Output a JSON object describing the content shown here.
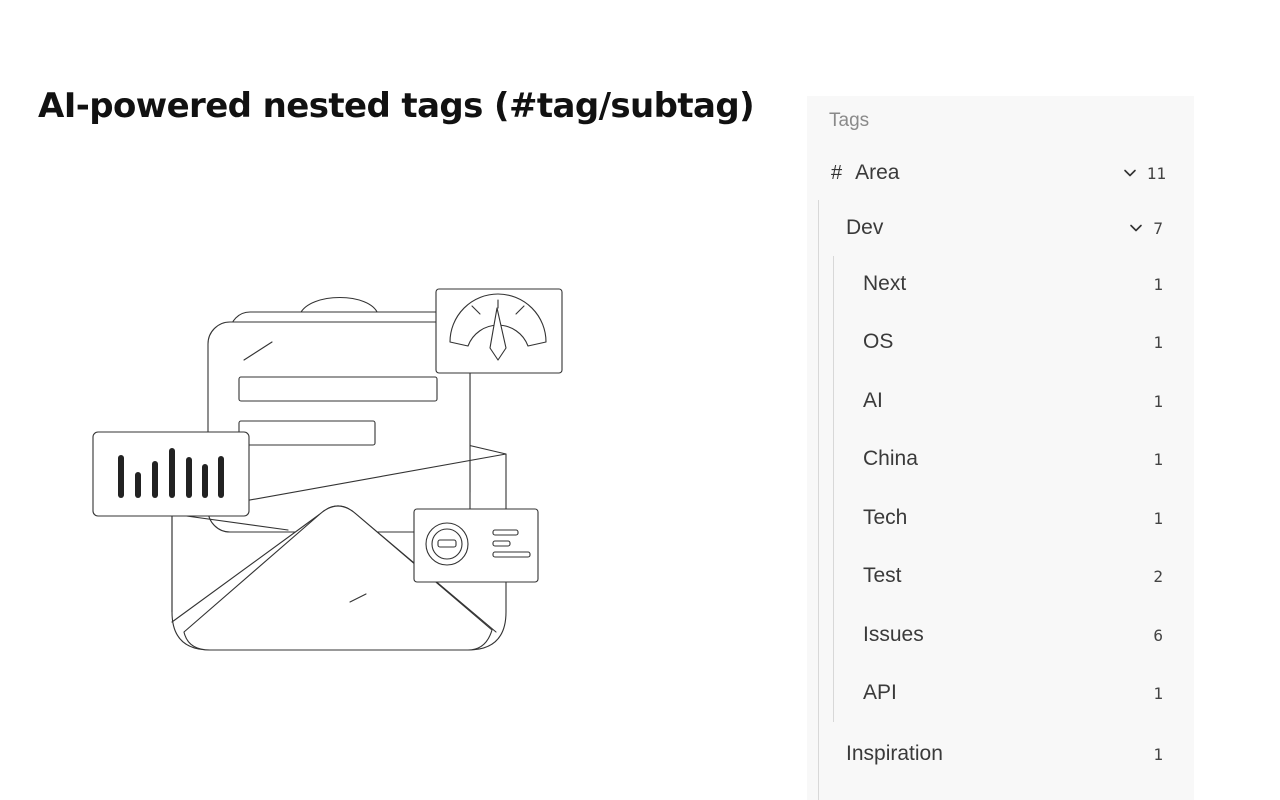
{
  "page": {
    "title": "AI-powered nested tags (#tag/subtag)"
  },
  "illustration": {
    "icons": [
      "envelope-icon",
      "gauge-icon",
      "bar-chart-icon",
      "dial-card-icon"
    ]
  },
  "tags_panel": {
    "heading": "Tags",
    "hash_symbol": "#",
    "root": {
      "label": "Area",
      "count": "11",
      "expanded": true
    },
    "dev": {
      "label": "Dev",
      "count": "7",
      "expanded": true
    },
    "dev_children": [
      {
        "label": "Next",
        "count": "1"
      },
      {
        "label": "OS",
        "count": "1"
      },
      {
        "label": "AI",
        "count": "1"
      },
      {
        "label": "China",
        "count": "1"
      },
      {
        "label": "Tech",
        "count": "1"
      },
      {
        "label": "Test",
        "count": "2"
      },
      {
        "label": "Issues",
        "count": "6"
      },
      {
        "label": "API",
        "count": "1"
      }
    ],
    "inspiration": {
      "label": "Inspiration",
      "count": "1"
    }
  },
  "colors": {
    "panel_background": "#f8f8f8",
    "heading_text": "#8a8a8a",
    "tree_line": "#d8d8d8"
  }
}
